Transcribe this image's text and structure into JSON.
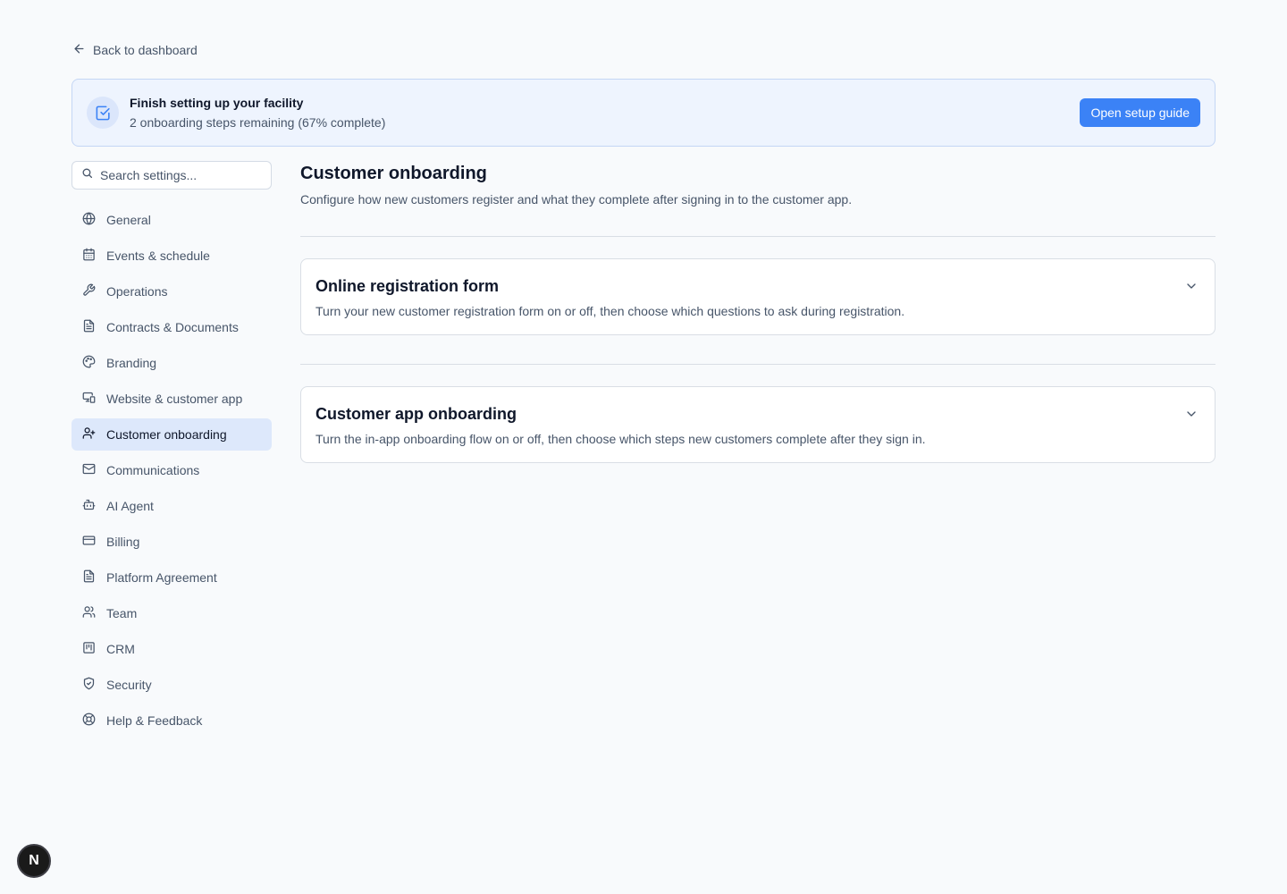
{
  "back_link": {
    "label": "Back to dashboard",
    "icon": "arrow-left-icon"
  },
  "setup_banner": {
    "title": "Finish setting up your facility",
    "subtitle": "2 onboarding steps remaining (67% complete)",
    "button_label": "Open setup guide",
    "icon": "checkbox-icon",
    "accent_color": "#3b82f6"
  },
  "search": {
    "placeholder": "Search settings...",
    "value": ""
  },
  "sidebar": {
    "items": [
      {
        "label": "General",
        "icon": "globe-icon",
        "active": false
      },
      {
        "label": "Events & schedule",
        "icon": "calendar-icon",
        "active": false
      },
      {
        "label": "Operations",
        "icon": "wrench-icon",
        "active": false
      },
      {
        "label": "Contracts & Documents",
        "icon": "document-icon",
        "active": false
      },
      {
        "label": "Branding",
        "icon": "palette-icon",
        "active": false
      },
      {
        "label": "Website & customer app",
        "icon": "devices-icon",
        "active": false
      },
      {
        "label": "Customer onboarding",
        "icon": "user-plus-icon",
        "active": true
      },
      {
        "label": "Communications",
        "icon": "mail-icon",
        "active": false
      },
      {
        "label": "AI Agent",
        "icon": "bot-icon",
        "active": false
      },
      {
        "label": "Billing",
        "icon": "credit-card-icon",
        "active": false
      },
      {
        "label": "Platform Agreement",
        "icon": "document-icon",
        "active": false
      },
      {
        "label": "Team",
        "icon": "users-icon",
        "active": false
      },
      {
        "label": "CRM",
        "icon": "kanban-icon",
        "active": false
      },
      {
        "label": "Security",
        "icon": "shield-icon",
        "active": false
      },
      {
        "label": "Help & Feedback",
        "icon": "lifebuoy-icon",
        "active": false
      }
    ]
  },
  "main": {
    "title": "Customer onboarding",
    "description": "Configure how new customers register and what they complete after signing in to the customer app.",
    "sections": [
      {
        "title": "Online registration form",
        "description": "Turn your new customer registration form on or off, then choose which questions to ask during registration."
      },
      {
        "title": "Customer app onboarding",
        "description": "Turn the in-app onboarding flow on or off, then choose which steps new customers complete after they sign in."
      }
    ]
  },
  "avatar": {
    "letter": "N"
  }
}
